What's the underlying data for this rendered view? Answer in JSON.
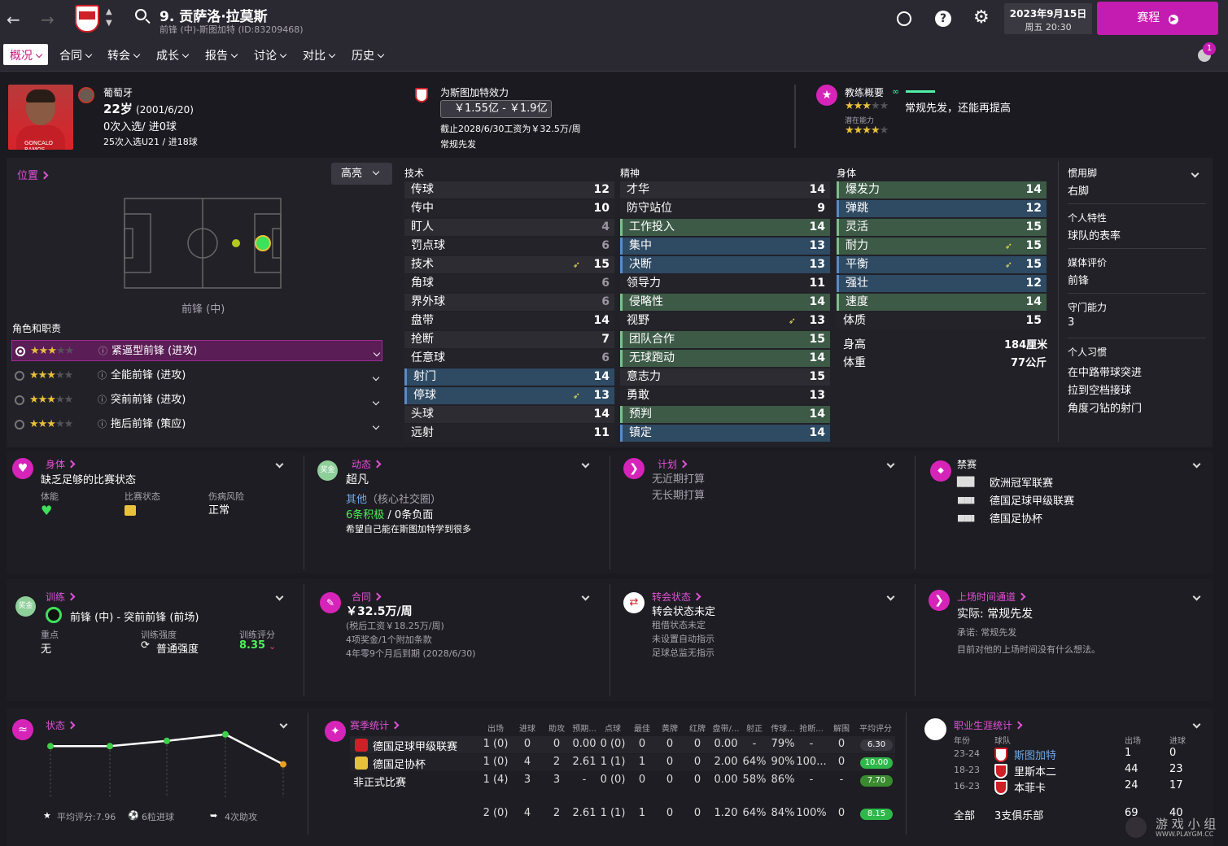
{
  "header": {
    "name": "9. 贡萨洛·拉莫斯",
    "subtitle": "前锋 (中)-斯图加特 (ID:83209468)",
    "date": "2023年9月15日",
    "time": "周五 20:30",
    "schedule_button": "赛程",
    "notif_count": "1"
  },
  "nav": [
    "概况",
    "合同",
    "转会",
    "成长",
    "报告",
    "讨论",
    "对比",
    "历史"
  ],
  "profile": {
    "nation": "葡萄牙",
    "age_bold": "22岁",
    "birth": "(2001/6/20)",
    "caps": "0次入选/ 进0球",
    "u21": "25次入选U21 / 进18球",
    "photo_caption": "GONCALO RAMOS"
  },
  "club": {
    "title": "为斯图加特效力",
    "value": "￥1.55亿 - ￥1.9亿",
    "contract": "截止2028/6/30工资为￥32.5万/周",
    "status": "常规先发"
  },
  "coach": {
    "title": "教练概要",
    "summary": "常规先发，还能再提高",
    "potential_label": "潜在能力"
  },
  "position": {
    "title": "位置",
    "highlight": "高亮",
    "pos_label": "前锋 (中)",
    "roles_title": "角色和职责",
    "roles": [
      "紧逼型前锋 (进攻)",
      "全能前锋 (进攻)",
      "突前前锋 (进攻)",
      "拖后前锋 (策应)"
    ]
  },
  "attributes": {
    "tech_title": "技术",
    "mental_title": "精神",
    "phys_title": "身体",
    "technical": [
      {
        "n": "传球",
        "v": "12"
      },
      {
        "n": "传中",
        "v": "10"
      },
      {
        "n": "盯人",
        "v": "4"
      },
      {
        "n": "罚点球",
        "v": "6"
      },
      {
        "n": "技术",
        "v": "15"
      },
      {
        "n": "角球",
        "v": "6"
      },
      {
        "n": "界外球",
        "v": "6"
      },
      {
        "n": "盘带",
        "v": "14"
      },
      {
        "n": "抢断",
        "v": "7"
      },
      {
        "n": "任意球",
        "v": "6"
      },
      {
        "n": "射门",
        "v": "14"
      },
      {
        "n": "停球",
        "v": "13"
      },
      {
        "n": "头球",
        "v": "14"
      },
      {
        "n": "远射",
        "v": "11"
      }
    ],
    "mental": [
      {
        "n": "才华",
        "v": "14"
      },
      {
        "n": "防守站位",
        "v": "9"
      },
      {
        "n": "工作投入",
        "v": "14"
      },
      {
        "n": "集中",
        "v": "13"
      },
      {
        "n": "决断",
        "v": "13"
      },
      {
        "n": "领导力",
        "v": "11"
      },
      {
        "n": "侵略性",
        "v": "14"
      },
      {
        "n": "视野",
        "v": "13"
      },
      {
        "n": "团队合作",
        "v": "15"
      },
      {
        "n": "无球跑动",
        "v": "14"
      },
      {
        "n": "意志力",
        "v": "15"
      },
      {
        "n": "勇敢",
        "v": "13"
      },
      {
        "n": "预判",
        "v": "14"
      },
      {
        "n": "镇定",
        "v": "14"
      }
    ],
    "physical": [
      {
        "n": "爆发力",
        "v": "14"
      },
      {
        "n": "弹跳",
        "v": "12"
      },
      {
        "n": "灵活",
        "v": "15"
      },
      {
        "n": "耐力",
        "v": "15"
      },
      {
        "n": "平衡",
        "v": "15"
      },
      {
        "n": "强壮",
        "v": "12"
      },
      {
        "n": "速度",
        "v": "14"
      },
      {
        "n": "体质",
        "v": "15"
      }
    ],
    "height_label": "身高",
    "height": "184厘米",
    "weight_label": "体重",
    "weight": "77公斤"
  },
  "side": {
    "foot_label": "惯用脚",
    "foot": "右脚",
    "traits_label": "个人特性",
    "traits": "球队的表率",
    "media_label": "媒体评价",
    "media": "前锋",
    "gk_label": "守门能力",
    "gk": "3",
    "habits_label": "个人习惯",
    "habits": [
      "在中路带球突进",
      "拉到空档接球",
      "角度刁钻的射门"
    ]
  },
  "cards": {
    "body": {
      "title": "身体",
      "summary": "缺乏足够的比赛状态",
      "c1": "体能",
      "c2": "比赛状态",
      "c3": "伤病风险",
      "c3v": "正常"
    },
    "dyn": {
      "title": "动态",
      "badge": "奖金",
      "summary": "超凡",
      "l1": "其他",
      "l1b": "（核心社交圈）",
      "l2a": "6条积极",
      "l2b": "/ 0条负面",
      "l3": "希望自己能在斯图加特学到很多"
    },
    "plan": {
      "title": "计划",
      "l1": "无近期打算",
      "l2": "无长期打算"
    },
    "ban": {
      "title": "禁赛",
      "items": [
        "欧洲冠军联赛",
        "德国足球甲级联赛",
        "德国足协杯"
      ]
    },
    "train": {
      "title": "训练",
      "badge": "奖金",
      "role": "前锋 (中) - 突前前锋 (前场)",
      "k1": "重点",
      "v1": "无",
      "k2": "训练强度",
      "v2": "普通强度",
      "k3": "训练评分",
      "v3": "8.35"
    },
    "contract": {
      "title": "合同",
      "wage": "￥32.5万/周",
      "l1": "(税后工资￥18.25万/周)",
      "l2": "4项奖金/1个附加条款",
      "l3": "4年零9个月后到期 (2028/6/30)"
    },
    "transfer": {
      "title": "转会状态",
      "l1": "转会状态未定",
      "l2": "租借状态未定",
      "l3": "未设置自动指示",
      "l4": "足球总监无指示"
    },
    "playtime": {
      "title": "上场时间通道",
      "l1": "实际: 常规先发",
      "l2": "承诺: 常规先发",
      "l3": "目前对他的上场时间没有什么想法。"
    }
  },
  "form": {
    "title": "状态",
    "avg": "平均评分:7.96",
    "goals": "6粒进球",
    "assists": "4次助攻"
  },
  "season": {
    "title": "赛季统计",
    "headers": [
      "出场",
      "进球",
      "助攻",
      "预期...",
      "点球",
      "最佳",
      "黄牌",
      "红牌",
      "盘带/...",
      "射正",
      "传球...",
      "抢断...",
      "解围",
      "平均评分"
    ],
    "rows": [
      {
        "name": "德国足球甲级联赛",
        "vals": [
          "1 (0)",
          "0",
          "0",
          "0.00",
          "0 (0)",
          "0",
          "0",
          "0",
          "0.00",
          "-",
          "79%",
          "-",
          "0"
        ],
        "rating": "6.30"
      },
      {
        "name": "德国足协杯",
        "vals": [
          "1 (0)",
          "4",
          "2",
          "2.61",
          "1 (1)",
          "1",
          "0",
          "0",
          "2.00",
          "64%",
          "90%",
          "100...",
          "0"
        ],
        "rating": "10.00"
      },
      {
        "name": "非正式比赛",
        "vals": [
          "1 (4)",
          "3",
          "3",
          "-",
          "0 (0)",
          "0",
          "0",
          "0",
          "0.00",
          "58%",
          "86%",
          "-",
          "-"
        ],
        "rating": "7.70"
      }
    ],
    "total": {
      "vals": [
        "2 (0)",
        "4",
        "2",
        "2.61",
        "1 (1)",
        "1",
        "0",
        "0",
        "1.20",
        "64%",
        "84%",
        "100%",
        "0"
      ],
      "rating": "8.15"
    }
  },
  "career": {
    "title": "职业生涯统计",
    "h_year": "年份",
    "h_team": "球队",
    "h_apps": "出场",
    "h_goals": "进球",
    "rows": [
      {
        "y": "23-24",
        "t": "斯图加特",
        "a": "1",
        "g": "0"
      },
      {
        "y": "18-23",
        "t": "里斯本二",
        "a": "44",
        "g": "23"
      },
      {
        "y": "16-23",
        "t": "本菲卡",
        "a": "24",
        "g": "17"
      }
    ],
    "total_label": "全部",
    "total_team": "3支俱乐部",
    "total_apps": "69",
    "total_goals": "40"
  },
  "watermark": {
    "cn": "游 戏 小 组",
    "url": "WWW.PLAYGM.CC"
  },
  "chart_data": {
    "type": "line",
    "title": "状态",
    "values": [
      6.3,
      6.3,
      6.7,
      7.2,
      4.9
    ]
  }
}
